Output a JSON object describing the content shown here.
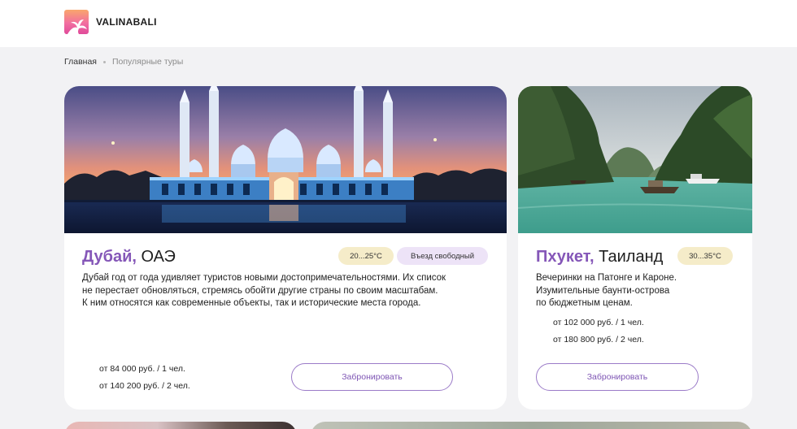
{
  "header": {
    "brand": "VALINABALI",
    "logo_icon": "palm-sunset-logo"
  },
  "breadcrumb": {
    "home": "Главная",
    "current": "Популярные туры"
  },
  "tours": [
    {
      "city": "Дубай,",
      "country": "ОАЭ",
      "temperature": "20...25°C",
      "badge": "Въезд свободный",
      "description": [
        "Дубай год от года удивляет туристов новыми достопримечательностями. Их список",
        "не перестает обновляться, стремясь обойти другие страны по своим масштабам.",
        "К ним относятся как современные объекты, так и исторические места города."
      ],
      "prices": [
        "от 84 000 руб. / 1 чел.",
        "от 140 200 руб. / 2 чел."
      ],
      "button": "Забронировать",
      "image": "mosque-night-photo"
    },
    {
      "city": "Пхукет,",
      "country": "Таиланд",
      "temperature": "30...35°C",
      "description": [
        "Вечеринки на Патонге и Кароне.",
        "Изумительные баунти-острова",
        "по бюджетным ценам."
      ],
      "prices": [
        "от 102 000 руб. / 1 чел.",
        "от 180 800 руб. / 2 чел."
      ],
      "button": "Забронировать",
      "image": "tropical-bay-photo"
    }
  ],
  "colors": {
    "accent": "#8557b8",
    "temp_pill": "#f5ecc9",
    "badge_pill": "#ede3f7",
    "page_bg": "#f2f2f4"
  }
}
